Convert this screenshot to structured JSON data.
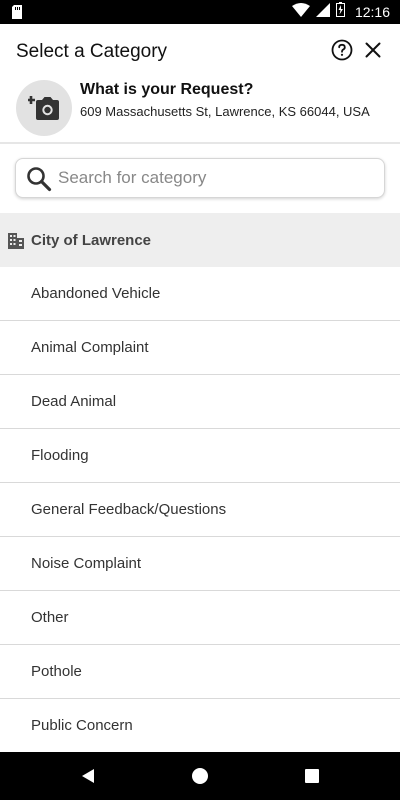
{
  "status_bar": {
    "time": "12:16"
  },
  "header": {
    "title": "Select a Category",
    "request_title": "What is your Request?",
    "address": "609 Massachusetts St, Lawrence, KS 66044, USA"
  },
  "search": {
    "placeholder": "Search for category"
  },
  "section": {
    "title": "City of Lawrence",
    "items": [
      "Abandoned Vehicle",
      "Animal Complaint",
      "Dead Animal",
      "Flooding",
      "General Feedback/Questions",
      "Noise Complaint",
      "Other",
      "Pothole",
      "Public Concern"
    ]
  },
  "icons": {
    "sd_card": "sd-card-icon",
    "wifi": "wifi-icon",
    "signal": "signal-icon",
    "battery": "battery-icon",
    "help": "help-icon",
    "close": "close-icon",
    "add_photo": "add-photo-icon",
    "search": "search-icon",
    "building": "building-icon",
    "back": "back-icon",
    "home": "home-icon",
    "recents": "recents-icon"
  }
}
